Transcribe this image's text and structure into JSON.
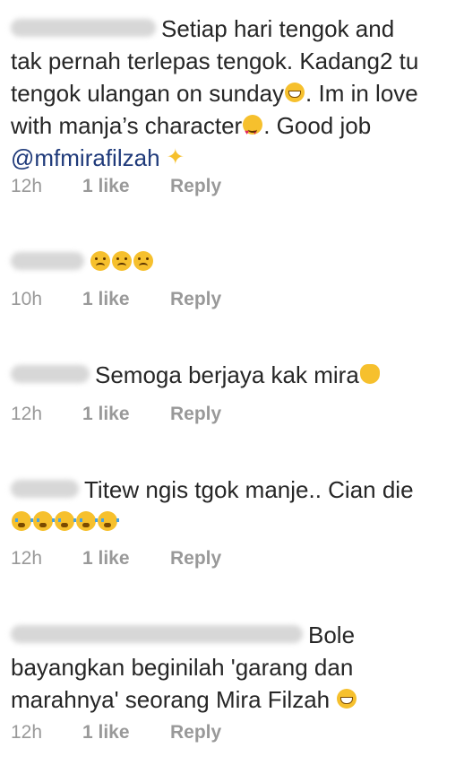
{
  "comments": [
    {
      "lines": [
        "Setiap hari tengok and",
        "tak pernah terlepas tengok. Kadang2 tu",
        "tengok ulangan on sunday",
        ". Im in love",
        "with manja’s character",
        ". Good job"
      ],
      "mention": "@mfmirafilzah",
      "time": "12h",
      "likes": "1 like",
      "reply": "Reply"
    },
    {
      "lines": [],
      "time": "10h",
      "likes": "1 like",
      "reply": "Reply"
    },
    {
      "lines": [
        "Semoga berjaya kak mira"
      ],
      "time": "12h",
      "likes": "1 like",
      "reply": "Reply"
    },
    {
      "lines": [
        "Titew ngis tgok manje.. Cian die"
      ],
      "time": "12h",
      "likes": "1 like",
      "reply": "Reply"
    },
    {
      "lines": [
        "Bole",
        "bayangkan beginilah 'garang dan",
        "marahnya' seorang Mira Filzah"
      ],
      "time": "12h",
      "likes": "1 like",
      "reply": "Reply"
    }
  ]
}
